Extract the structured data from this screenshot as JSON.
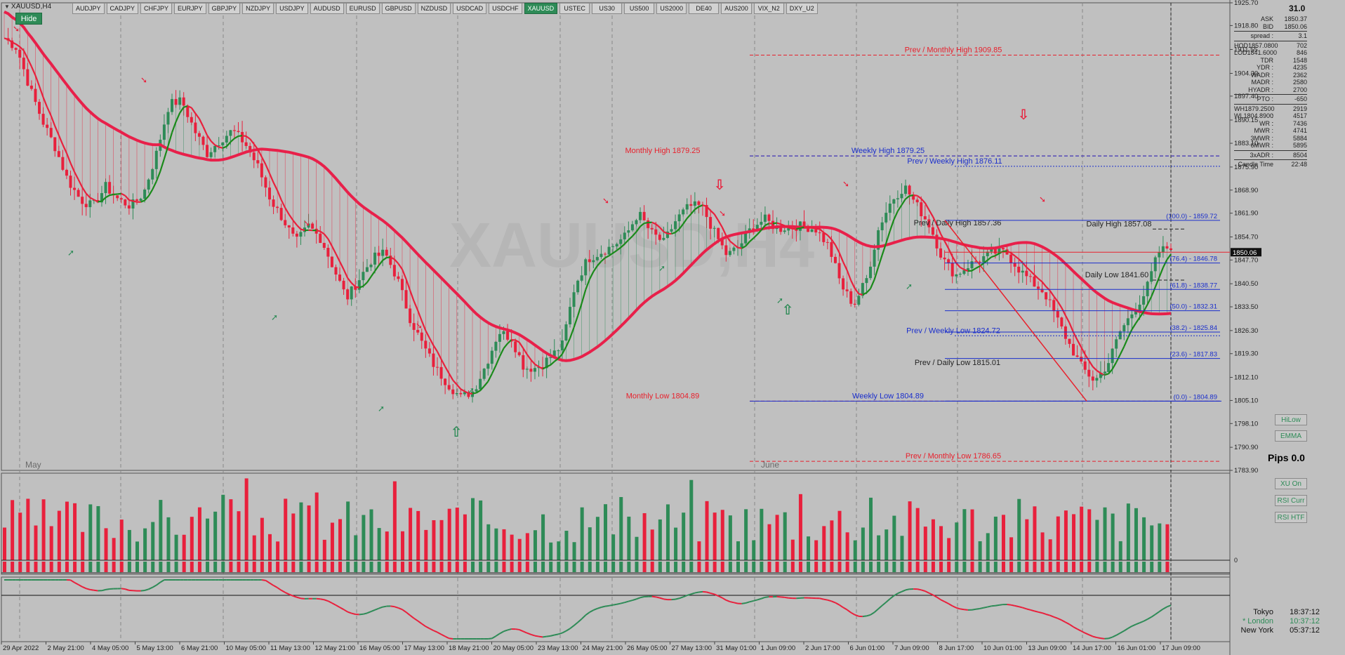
{
  "window": {
    "symbol_label": "XAUUSD,H4",
    "hide_label": "Hide"
  },
  "symbols": [
    "AUDJPY",
    "CADJPY",
    "CHFJPY",
    "EURJPY",
    "GBPJPY",
    "NZDJPY",
    "USDJPY",
    "AUDUSD",
    "EURUSD",
    "GBPUSD",
    "NZDUSD",
    "USDCAD",
    "USDCHF",
    "XAUUSD",
    "USTEC",
    "US30",
    "US500",
    "US2000",
    "DE40",
    "AUS200",
    "VIX_N2",
    "DXY_U2"
  ],
  "active_symbol": "XAUUSD",
  "watermark": "XAUUSD,H4",
  "top_value": "31.0",
  "info_panel": [
    {
      "k": "ASK",
      "v": "1850.37"
    },
    {
      "k": "BID",
      "v": "1850.06"
    },
    {
      "sep": true
    },
    {
      "k": "spread :",
      "v": "3.1"
    },
    {
      "sep": true
    },
    {
      "k": "HOD1857.0800",
      "v": "702"
    },
    {
      "k": "LOD1841.6000",
      "v": "846"
    },
    {
      "k": "TDR",
      "v": "1548"
    },
    {
      "k": "YDR :",
      "v": "4235"
    },
    {
      "k": "WADR :",
      "v": "2362"
    },
    {
      "k": "MADR :",
      "v": "2580"
    },
    {
      "k": "HYADR :",
      "v": "2700"
    },
    {
      "sep": true
    },
    {
      "k": "PTO :",
      "v": "-650"
    },
    {
      "sep": true
    },
    {
      "k": "WH1879.2500 :",
      "v": "2919"
    },
    {
      "k": "WL1804.8900 :",
      "v": "4517"
    },
    {
      "k": "WR :",
      "v": "7436"
    },
    {
      "k": "MWR :",
      "v": "4741"
    },
    {
      "k": "3MWR :",
      "v": "5884"
    },
    {
      "k": "6MWR :",
      "v": "5895"
    },
    {
      "sep": true
    },
    {
      "k": "3xADR :",
      "v": "8504"
    },
    {
      "sep": true
    },
    {
      "k": "Candle Time",
      "v": "22:48"
    }
  ],
  "price_axis": [
    "1925.70",
    "1918.80",
    "1911.55",
    "1904.30",
    "1897.40",
    "1890.15",
    "1883.10",
    "1875.90",
    "1868.90",
    "1861.90",
    "1854.70",
    "1847.70",
    "1840.50",
    "1833.50",
    "1826.30",
    "1819.30",
    "1812.10",
    "1805.10",
    "1798.10",
    "1790.90",
    "1783.90"
  ],
  "current_price": "1850.06",
  "levels": [
    {
      "text": "Prev / Monthly High 1909.85",
      "price": 1909.85,
      "color": "#e8202c",
      "style": "dash"
    },
    {
      "text": "Monthly High 1879.25",
      "price": 1879.25,
      "color": "#e8202c",
      "style": "dash"
    },
    {
      "text": "Weekly High 1879.25",
      "price": 1879.25,
      "color": "#1a2ecc",
      "style": "dash"
    },
    {
      "text": "Prev / Weekly High 1876.11",
      "price": 1876.11,
      "color": "#1a2ecc",
      "style": "dot"
    },
    {
      "text": "Monthly Low 1804.89",
      "price": 1804.89,
      "color": "#e8202c",
      "style": "dash"
    },
    {
      "text": "Weekly Low 1804.89",
      "price": 1804.89,
      "color": "#1a2ecc",
      "style": "solid"
    },
    {
      "text": "Prev / Monthly Low 1786.65",
      "price": 1786.65,
      "color": "#e8202c",
      "style": "dash"
    },
    {
      "text": "Prev / Daily High 1857.36",
      "price": 1857.36,
      "color": "#222222",
      "style": "none"
    },
    {
      "text": "Daily High 1857.08",
      "price": 1857.08,
      "color": "#222222",
      "style": "dash"
    },
    {
      "text": "Daily Low 1841.60",
      "price": 1841.6,
      "color": "#222222",
      "style": "dash"
    },
    {
      "text": "Prev / Weekly Low 1824.72",
      "price": 1824.72,
      "color": "#1a2ecc",
      "style": "dot"
    },
    {
      "text": "Prev / Daily Low 1815.01",
      "price": 1815.01,
      "color": "#222222",
      "style": "none"
    }
  ],
  "fib_levels": [
    {
      "text": "(100.0) - 1859.72",
      "price": 1859.72
    },
    {
      "text": "(76.4) - 1846.78",
      "price": 1846.78
    },
    {
      "text": "(61.8) - 1838.77",
      "price": 1838.77
    },
    {
      "text": "(50.0) - 1832.31",
      "price": 1832.31
    },
    {
      "text": "(38.2) - 1825.84",
      "price": 1825.84
    },
    {
      "text": "(23.6) - 1817.83",
      "price": 1817.83
    },
    {
      "text": "(0.0) - 1804.89",
      "price": 1804.89
    }
  ],
  "month_labels": [
    "May",
    "June"
  ],
  "date_axis": [
    "29 Apr 2022",
    "2 May 21:00",
    "4 May 05:00",
    "5 May 13:00",
    "6 May 21:00",
    "10 May 05:00",
    "11 May 13:00",
    "12 May 21:00",
    "16 May 05:00",
    "17 May 13:00",
    "18 May 21:00",
    "20 May 05:00",
    "23 May 13:00",
    "24 May 21:00",
    "26 May 05:00",
    "27 May 13:00",
    "31 May 01:00",
    "1 Jun 09:00",
    "2 Jun 17:00",
    "6 Jun 01:00",
    "7 Jun 09:00",
    "8 Jun 17:00",
    "10 Jun 01:00",
    "13 Jun 09:00",
    "14 Jun 17:00",
    "16 Jun 01:00",
    "17 Jun 09:00"
  ],
  "side_buttons": {
    "hilow": "HiLow",
    "emma": "EMMA",
    "xu_on": "XU On",
    "rsi_curr": "RSI Curr",
    "rsi_htf": "RSI HTF"
  },
  "pips": "Pips 0.0",
  "volume_axis_zero": "0",
  "clocks": [
    {
      "city": "Tokyo",
      "time": "18:37:12"
    },
    {
      "city": "* London",
      "time": "10:37:12"
    },
    {
      "city": "New York",
      "time": "05:37:12"
    }
  ],
  "colors": {
    "bull": "#2e8b57",
    "bear": "#e8203c",
    "ma": "#e8204a",
    "fast_bull": "#1a8a1a",
    "background": "#c0c0c0",
    "grid": "#a8a8a8",
    "fib": "#1a2ecc"
  },
  "chart_data": {
    "type": "candlestick",
    "title": "XAUUSD,H4",
    "ylim": [
      1783.9,
      1925.7
    ],
    "close_path": [
      1915,
      1912,
      1900,
      1890,
      1882,
      1872,
      1866,
      1864,
      1870,
      1866,
      1864,
      1868,
      1880,
      1895,
      1896,
      1887,
      1880,
      1884,
      1887,
      1883,
      1876,
      1866,
      1860,
      1853,
      1858,
      1854,
      1845,
      1836,
      1842,
      1848,
      1850,
      1842,
      1830,
      1822,
      1815,
      1810,
      1806,
      1808,
      1816,
      1826,
      1824,
      1815,
      1815,
      1818,
      1822,
      1840,
      1848,
      1850,
      1852,
      1855,
      1862,
      1856,
      1853,
      1860,
      1864,
      1864,
      1856,
      1849,
      1852,
      1858,
      1860,
      1857,
      1858,
      1858,
      1857,
      1852,
      1840,
      1834,
      1842,
      1858,
      1866,
      1870,
      1864,
      1858,
      1848,
      1843,
      1846,
      1848,
      1850,
      1850,
      1845,
      1841,
      1838,
      1830,
      1822,
      1815,
      1811,
      1816,
      1826,
      1832,
      1838,
      1850,
      1852
    ]
  }
}
